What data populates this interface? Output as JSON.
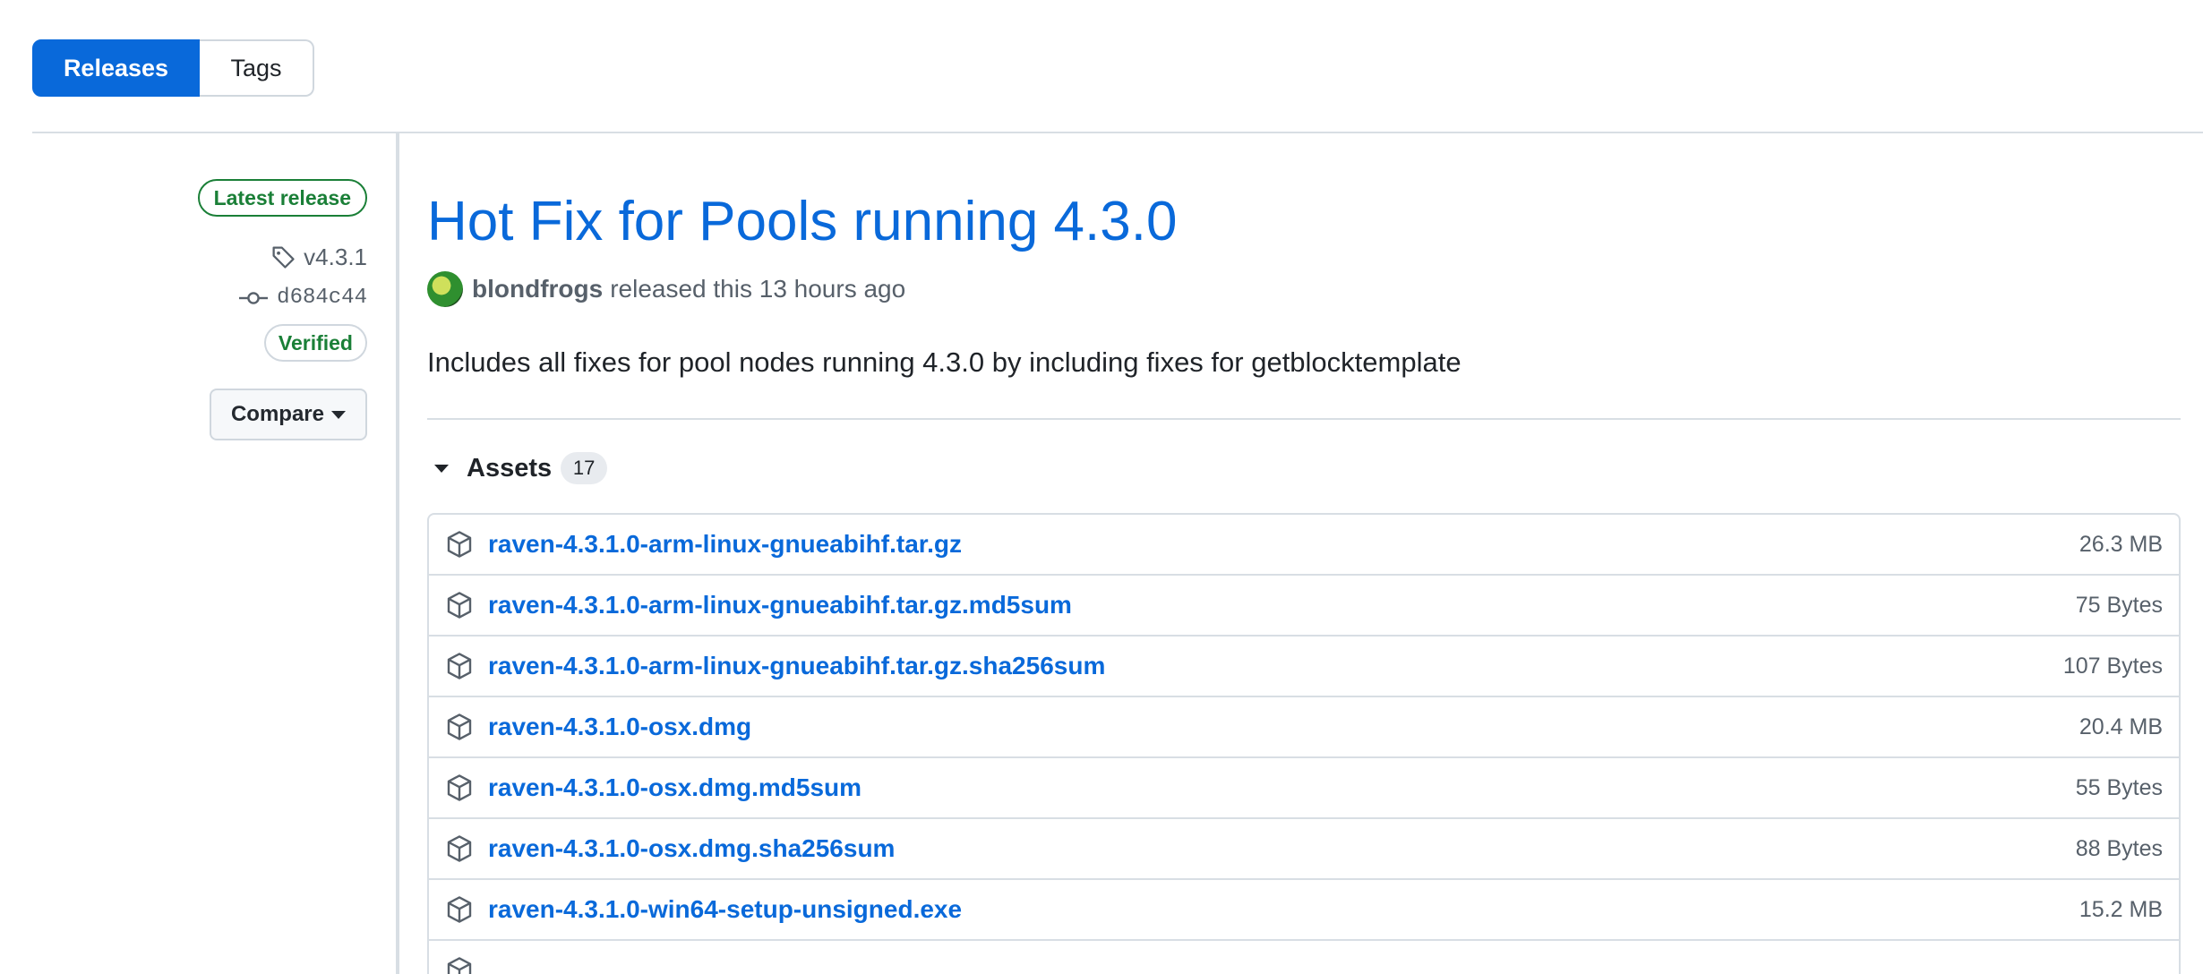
{
  "tabs": {
    "releases": "Releases",
    "tags": "Tags"
  },
  "sidebar": {
    "latest_badge": "Latest release",
    "tag": "v4.3.1",
    "commit": "d684c44",
    "verified_badge": "Verified",
    "compare_label": "Compare"
  },
  "release": {
    "title": "Hot Fix for Pools running 4.3.0",
    "author": "blondfrogs",
    "released_text": "released this 13 hours ago",
    "description": "Includes all fixes for pool nodes running 4.3.0 by including fixes for getblocktemplate"
  },
  "assets": {
    "label": "Assets",
    "count": "17",
    "items": [
      {
        "name": "raven-4.3.1.0-arm-linux-gnueabihf.tar.gz",
        "size": "26.3 MB"
      },
      {
        "name": "raven-4.3.1.0-arm-linux-gnueabihf.tar.gz.md5sum",
        "size": "75 Bytes"
      },
      {
        "name": "raven-4.3.1.0-arm-linux-gnueabihf.tar.gz.sha256sum",
        "size": "107 Bytes"
      },
      {
        "name": "raven-4.3.1.0-osx.dmg",
        "size": "20.4 MB"
      },
      {
        "name": "raven-4.3.1.0-osx.dmg.md5sum",
        "size": "55 Bytes"
      },
      {
        "name": "raven-4.3.1.0-osx.dmg.sha256sum",
        "size": "88 Bytes"
      },
      {
        "name": "raven-4.3.1.0-win64-setup-unsigned.exe",
        "size": "15.2 MB"
      },
      {
        "name": "",
        "size": ""
      }
    ]
  },
  "icons": {
    "tag": "tag-icon",
    "commit": "git-commit-icon",
    "package": "package-icon",
    "caret": "triangle-down-icon"
  }
}
